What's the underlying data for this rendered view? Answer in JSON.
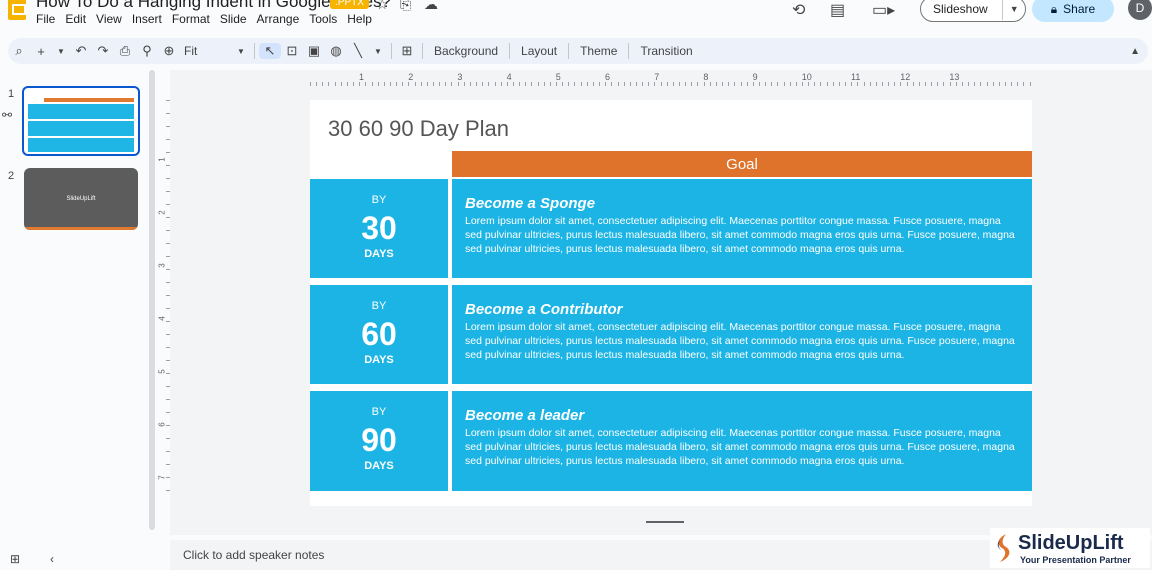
{
  "window": {
    "title": "How To Do a Hanging Indent in Google Slides?",
    "extension": ".PPTX"
  },
  "menu": [
    "File",
    "Edit",
    "View",
    "Insert",
    "Format",
    "Slide",
    "Arrange",
    "Tools",
    "Help"
  ],
  "header_actions": {
    "slideshow_label": "Slideshow",
    "share_label": "Share",
    "avatar_initial": "D"
  },
  "toolbar": {
    "zoom_label": "Fit",
    "background_label": "Background",
    "layout_label": "Layout",
    "theme_label": "Theme",
    "transition_label": "Transition"
  },
  "filmstrip": {
    "slides": [
      {
        "number": "1",
        "label": "30 60 90 Day Plan"
      },
      {
        "number": "2",
        "label": "SlideUpLift"
      }
    ]
  },
  "ruler": {
    "horizontal": [
      "1",
      "2",
      "3",
      "4",
      "5",
      "6",
      "7",
      "8",
      "9",
      "10",
      "11",
      "12",
      "13"
    ],
    "vertical": [
      "1",
      "2",
      "3",
      "4",
      "5",
      "6",
      "7"
    ]
  },
  "slide": {
    "title": "30 60 90 Day Plan",
    "goal_header": "Goal",
    "rows": [
      {
        "by": "BY",
        "number": "30",
        "days": "DAYS",
        "heading": "Become a Sponge",
        "body": "Lorem ipsum dolor sit amet, consectetuer adipiscing elit. Maecenas porttitor congue massa. Fusce posuere, magna sed pulvinar ultricies, purus lectus malesuada libero, sit amet commodo magna eros quis urna. Fusce posuere, magna sed pulvinar ultricies, purus lectus malesuada libero, sit amet commodo magna eros quis urna."
      },
      {
        "by": "BY",
        "number": "60",
        "days": "DAYS",
        "heading": "Become a Contributor",
        "body": "Lorem ipsum dolor sit amet, consectetuer adipiscing elit. Maecenas porttitor congue massa. Fusce posuere, magna sed pulvinar ultricies, purus lectus malesuada libero, sit amet commodo magna eros quis urna. Fusce posuere, magna sed pulvinar ultricies, purus lectus malesuada libero, sit amet commodo magna eros quis urna."
      },
      {
        "by": "BY",
        "number": "90",
        "days": "DAYS",
        "heading": "Become a leader",
        "body": "Lorem ipsum dolor sit amet, consectetuer adipiscing elit. Maecenas porttitor congue massa. Fusce posuere, magna sed pulvinar ultricies, purus lectus malesuada libero, sit amet commodo magna eros quis urna. Fusce posuere, magna sed pulvinar ultricies, purus lectus malesuada libero, sit amet commodo magna eros quis urna."
      }
    ]
  },
  "notes": {
    "placeholder": "Click to add speaker notes"
  },
  "watermark": {
    "brand": "SlideUpLift",
    "tagline": "Your Presentation Partner"
  },
  "colors": {
    "accent_orange": "#e0732c",
    "accent_blue": "#1cb4e4",
    "share_bg": "#c2e7ff"
  }
}
